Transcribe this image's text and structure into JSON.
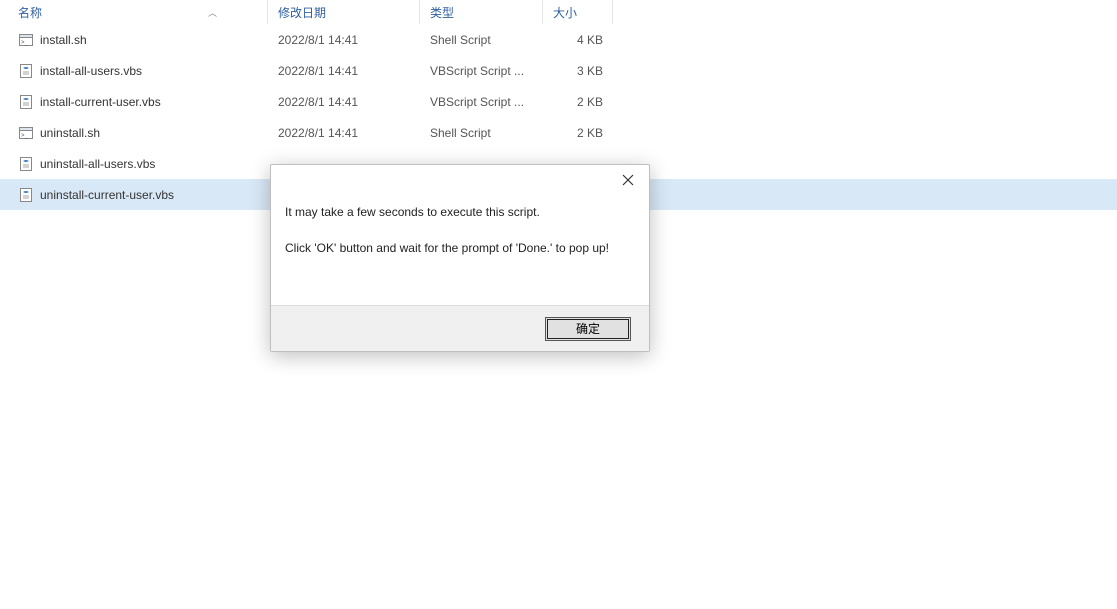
{
  "columns": {
    "name": "名称",
    "date": "修改日期",
    "type": "类型",
    "size": "大小"
  },
  "files": [
    {
      "name": "install.sh",
      "date": "2022/8/1 14:41",
      "type": "Shell Script",
      "size": "4 KB",
      "icon": "sh"
    },
    {
      "name": "install-all-users.vbs",
      "date": "2022/8/1 14:41",
      "type": "VBScript Script ...",
      "size": "3 KB",
      "icon": "vbs"
    },
    {
      "name": "install-current-user.vbs",
      "date": "2022/8/1 14:41",
      "type": "VBScript Script ...",
      "size": "2 KB",
      "icon": "vbs"
    },
    {
      "name": "uninstall.sh",
      "date": "2022/8/1 14:41",
      "type": "Shell Script",
      "size": "2 KB",
      "icon": "sh"
    },
    {
      "name": "uninstall-all-users.vbs",
      "date": "",
      "type": "",
      "size": "",
      "icon": "vbs"
    },
    {
      "name": "uninstall-current-user.vbs",
      "date": "",
      "type": "",
      "size": "",
      "icon": "vbs"
    }
  ],
  "selected_index": 5,
  "dialog": {
    "line1": "It may take a few seconds to execute this script.",
    "line2": "Click 'OK' button and wait for the prompt of 'Done.' to pop up!",
    "ok": "确定"
  }
}
